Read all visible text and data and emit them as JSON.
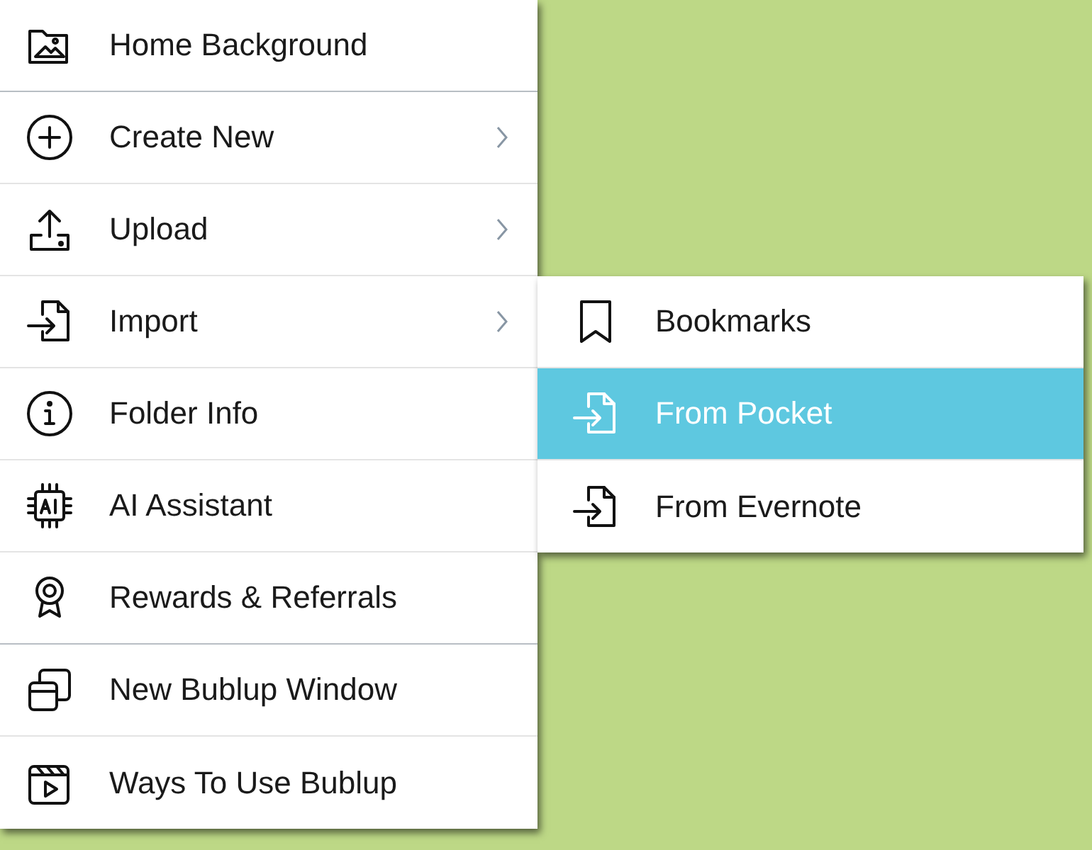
{
  "menu": {
    "items": [
      {
        "label": "Home Background",
        "has_submenu": false,
        "separator_after": true
      },
      {
        "label": "Create New",
        "has_submenu": true,
        "separator_after": false
      },
      {
        "label": "Upload",
        "has_submenu": true,
        "separator_after": false
      },
      {
        "label": "Import",
        "has_submenu": true,
        "separator_after": false
      },
      {
        "label": "Folder Info",
        "has_submenu": false,
        "separator_after": false
      },
      {
        "label": "AI Assistant",
        "has_submenu": false,
        "separator_after": false
      },
      {
        "label": "Rewards & Referrals",
        "has_submenu": false,
        "separator_after": true
      },
      {
        "label": "New Bublup Window",
        "has_submenu": false,
        "separator_after": false
      },
      {
        "label": "Ways To Use Bublup",
        "has_submenu": false,
        "separator_after": false
      }
    ]
  },
  "submenu": {
    "items": [
      {
        "label": "Bookmarks",
        "selected": false
      },
      {
        "label": "From Pocket",
        "selected": true
      },
      {
        "label": "From Evernote",
        "selected": false
      }
    ]
  }
}
